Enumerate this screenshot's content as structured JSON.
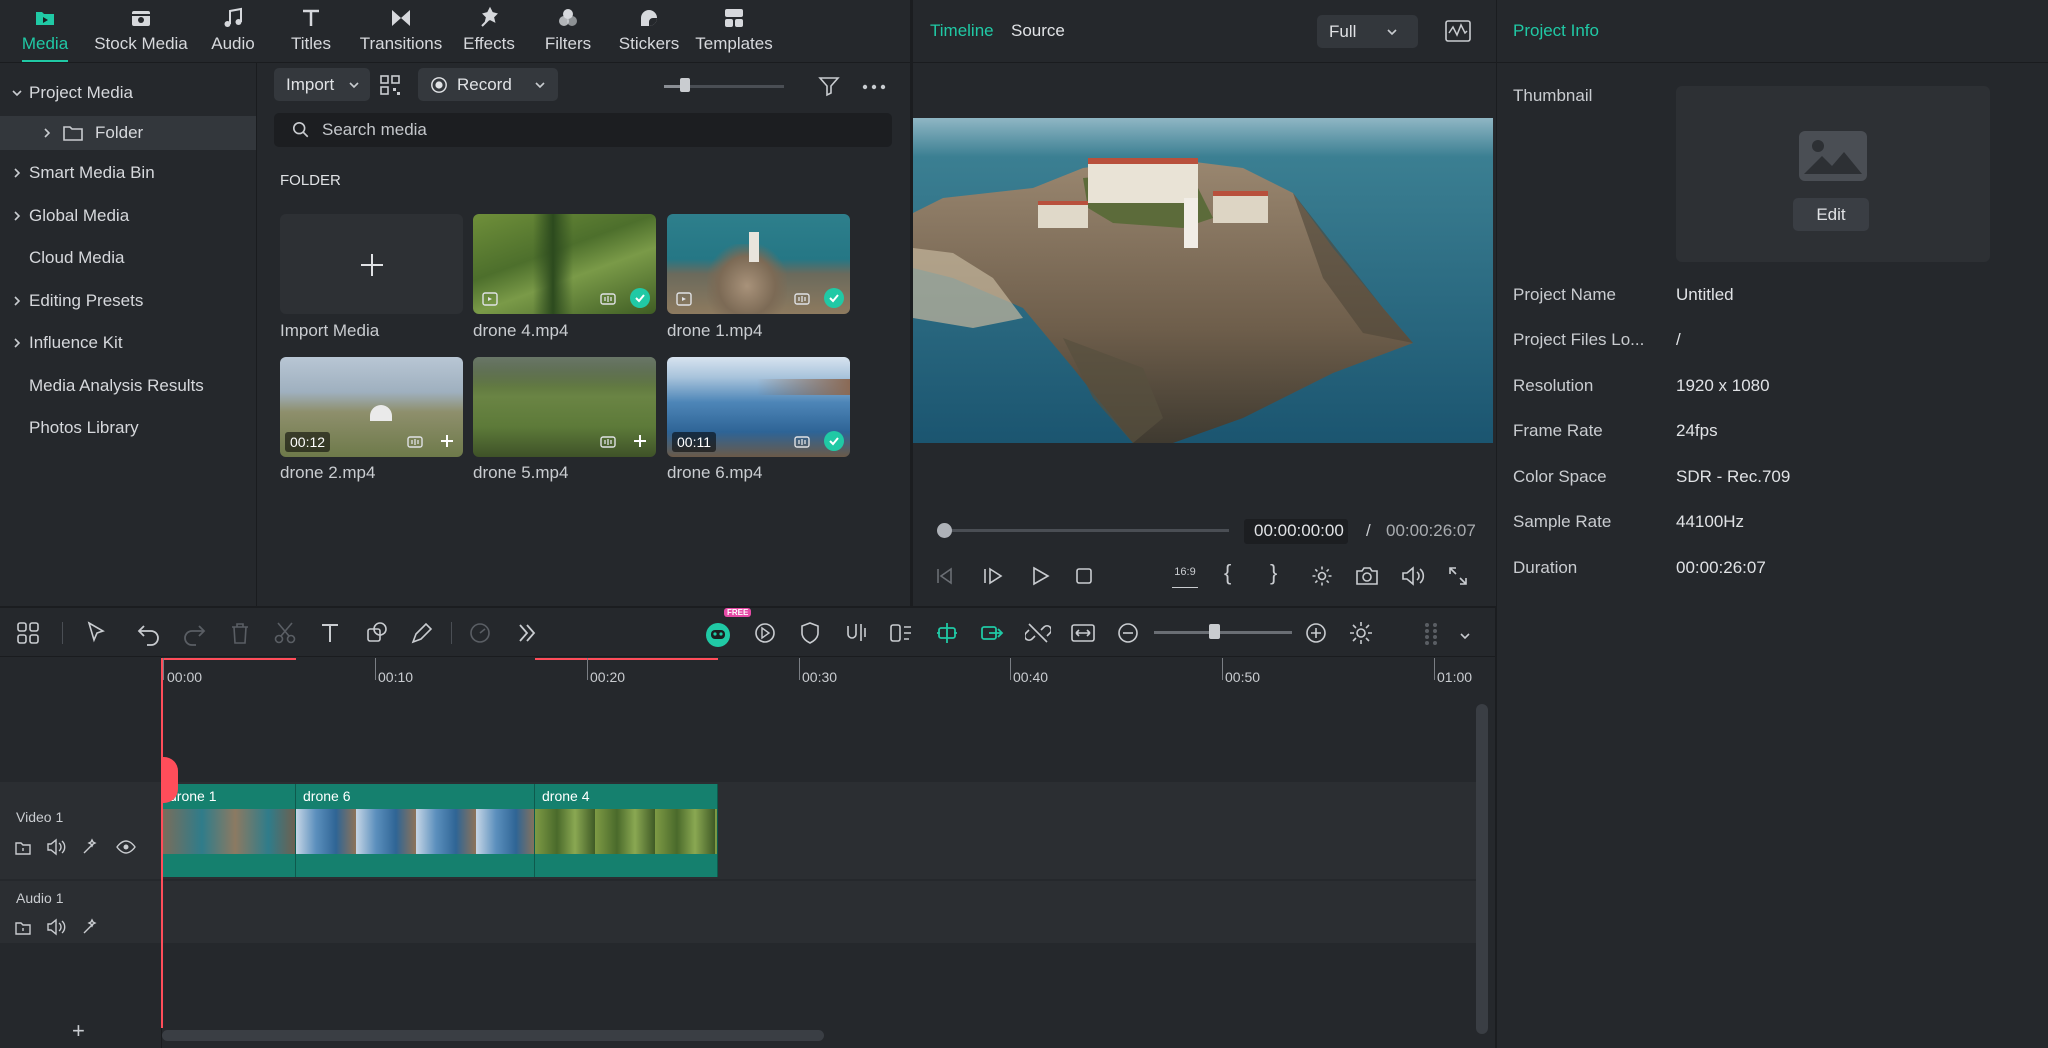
{
  "top_tabs": [
    {
      "label": "Media",
      "icon": "media-icon",
      "active": true
    },
    {
      "label": "Stock Media",
      "icon": "stock-media-icon"
    },
    {
      "label": "Audio",
      "icon": "music-note-icon"
    },
    {
      "label": "Titles",
      "icon": "titles-icon"
    },
    {
      "label": "Transitions",
      "icon": "transitions-icon"
    },
    {
      "label": "Effects",
      "icon": "effects-icon"
    },
    {
      "label": "Filters",
      "icon": "filters-icon"
    },
    {
      "label": "Stickers",
      "icon": "stickers-icon"
    },
    {
      "label": "Templates",
      "icon": "templates-icon"
    }
  ],
  "sidebar": {
    "items": [
      {
        "label": "Project Media",
        "expanded": true
      },
      {
        "label": "Folder",
        "selected": true
      },
      {
        "label": "Smart Media Bin"
      },
      {
        "label": "Global Media"
      },
      {
        "label": "Cloud Media"
      },
      {
        "label": "Editing Presets"
      },
      {
        "label": "Influence Kit"
      },
      {
        "label": "Media Analysis Results"
      },
      {
        "label": "Photos Library"
      }
    ]
  },
  "media_toolbar": {
    "import_label": "Import",
    "record_label": "Record"
  },
  "search": {
    "placeholder": "Search media"
  },
  "folder_heading": "FOLDER",
  "media_items": [
    {
      "name": "Import Media"
    },
    {
      "name": "drone 4.mp4",
      "checked": true
    },
    {
      "name": "drone 1.mp4",
      "checked": true
    },
    {
      "name": "drone 2.mp4",
      "duration": "00:12"
    },
    {
      "name": "drone 5.mp4"
    },
    {
      "name": "drone 6.mp4",
      "duration": "00:11",
      "checked": true
    }
  ],
  "player": {
    "tab_timeline": "Timeline",
    "tab_source": "Source",
    "quality": "Full",
    "current_time": "00:00:00:00",
    "separator": "/",
    "total_time": "00:00:26:07",
    "aspect_label": "16:9",
    "progress": 0.0
  },
  "info": {
    "title": "Project Info",
    "thumbnail_label": "Thumbnail",
    "edit_label": "Edit",
    "rows": [
      {
        "label": "Project Name",
        "value": "Untitled"
      },
      {
        "label": "Project Files Lo...",
        "value": "/"
      },
      {
        "label": "Resolution",
        "value": "1920 x 1080"
      },
      {
        "label": "Frame Rate",
        "value": "24fps"
      },
      {
        "label": "Color Space",
        "value": "SDR - Rec.709"
      },
      {
        "label": "Sample Rate",
        "value": "44100Hz"
      },
      {
        "label": "Duration",
        "value": "00:00:26:07"
      }
    ]
  },
  "timeline": {
    "ruler": [
      "00:00",
      "00:10",
      "00:20",
      "00:30",
      "00:40",
      "00:50",
      "01:00"
    ],
    "free_badge": "FREE",
    "tracks": {
      "video_label": "Video 1",
      "audio_label": "Audio 1"
    },
    "clips": [
      {
        "name": "drone 1"
      },
      {
        "name": "drone 6"
      },
      {
        "name": "drone 4"
      }
    ]
  },
  "colors": {
    "accent": "#20c9a5",
    "clip": "#15806e",
    "playhead": "#ff4d5a"
  }
}
